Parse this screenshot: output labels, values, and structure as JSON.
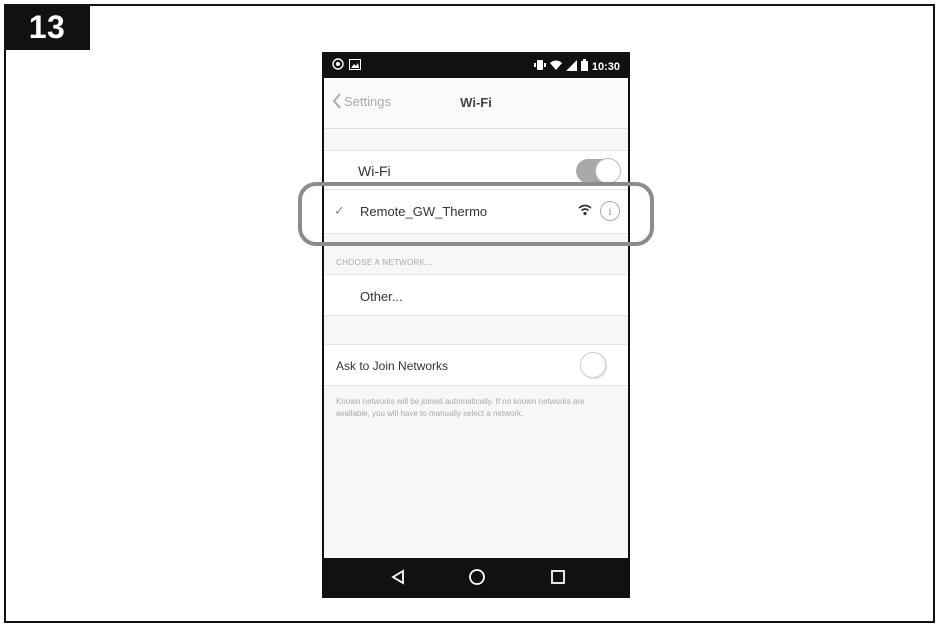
{
  "step": {
    "number": "13"
  },
  "statusbar": {
    "time": "10:30"
  },
  "header": {
    "back_label": "Settings",
    "title": "Wi-Fi"
  },
  "wifi": {
    "label": "Wi-Fi",
    "enabled": true
  },
  "connected_network": {
    "name": "Remote_GW_Thermo",
    "checkmark": "✓"
  },
  "choose_section": {
    "header": "CHOOSE A NETWORK...",
    "other_label": "Other..."
  },
  "ask_to_join": {
    "label": "Ask to Join Networks",
    "enabled": false,
    "footnote": "Known networks will be joined automatically. If no known networks are available, you will have to manually select a network."
  },
  "icons": {
    "status_left": [
      "whatsapp-icon",
      "image-icon"
    ],
    "status_right": [
      "vibrate-icon",
      "wifi-icon",
      "signal-icon",
      "battery-icon"
    ],
    "nav": [
      "back-triangle-icon",
      "home-circle-icon",
      "recents-square-icon"
    ]
  },
  "colors": {
    "highlight": "#8c8c8c",
    "bars": "#111111",
    "toggle_on": "#a9a9a9"
  }
}
